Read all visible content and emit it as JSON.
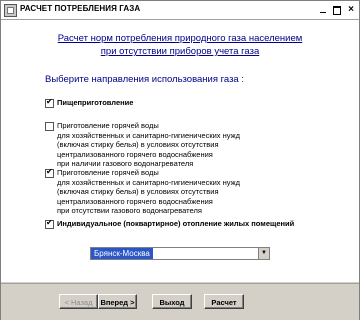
{
  "window": {
    "title": "РАСЧЕТ ПОТРЕБЛЕНИЯ ГАЗА",
    "close_glyph": "×"
  },
  "heading": {
    "line1": "Расчет норм потребления природного газа населением",
    "line2": "при отсутствии приборов учета газа"
  },
  "subheading": "Выберите направления использования газа :",
  "options": [
    {
      "checked": true,
      "label": "Пищеприготовление",
      "details": []
    },
    {
      "checked": false,
      "label": "Приготовление горячей воды",
      "details": [
        "для хозяйственных и санитарно-гигиенических нужд",
        "(включая стирку белья) в условиях отсутствия",
        "централизованного горячего водоснабжения",
        "при наличии газового водонагревателя"
      ]
    },
    {
      "checked": true,
      "label": "Приготовление горячей воды",
      "details": [
        "для хозяйственных и санитарно-гигиенических нужд",
        "(включая стирку белья) в условиях отсутствия",
        "централизованного горячего водоснабжения",
        "при отсутствии газового водонагревателя"
      ]
    },
    {
      "checked": true,
      "label": "Индивидуальное (поквартирное) отопление жилых помещений",
      "details": []
    }
  ],
  "region_select": {
    "value": "Брянск-Москва"
  },
  "buttons": {
    "back": "< Назад",
    "next": "Вперед >",
    "exit": "Выход",
    "calc": "Расчет"
  },
  "colors": {
    "heading": "#00008b",
    "selection": "#2a56c6",
    "face": "#d4d0c8"
  }
}
